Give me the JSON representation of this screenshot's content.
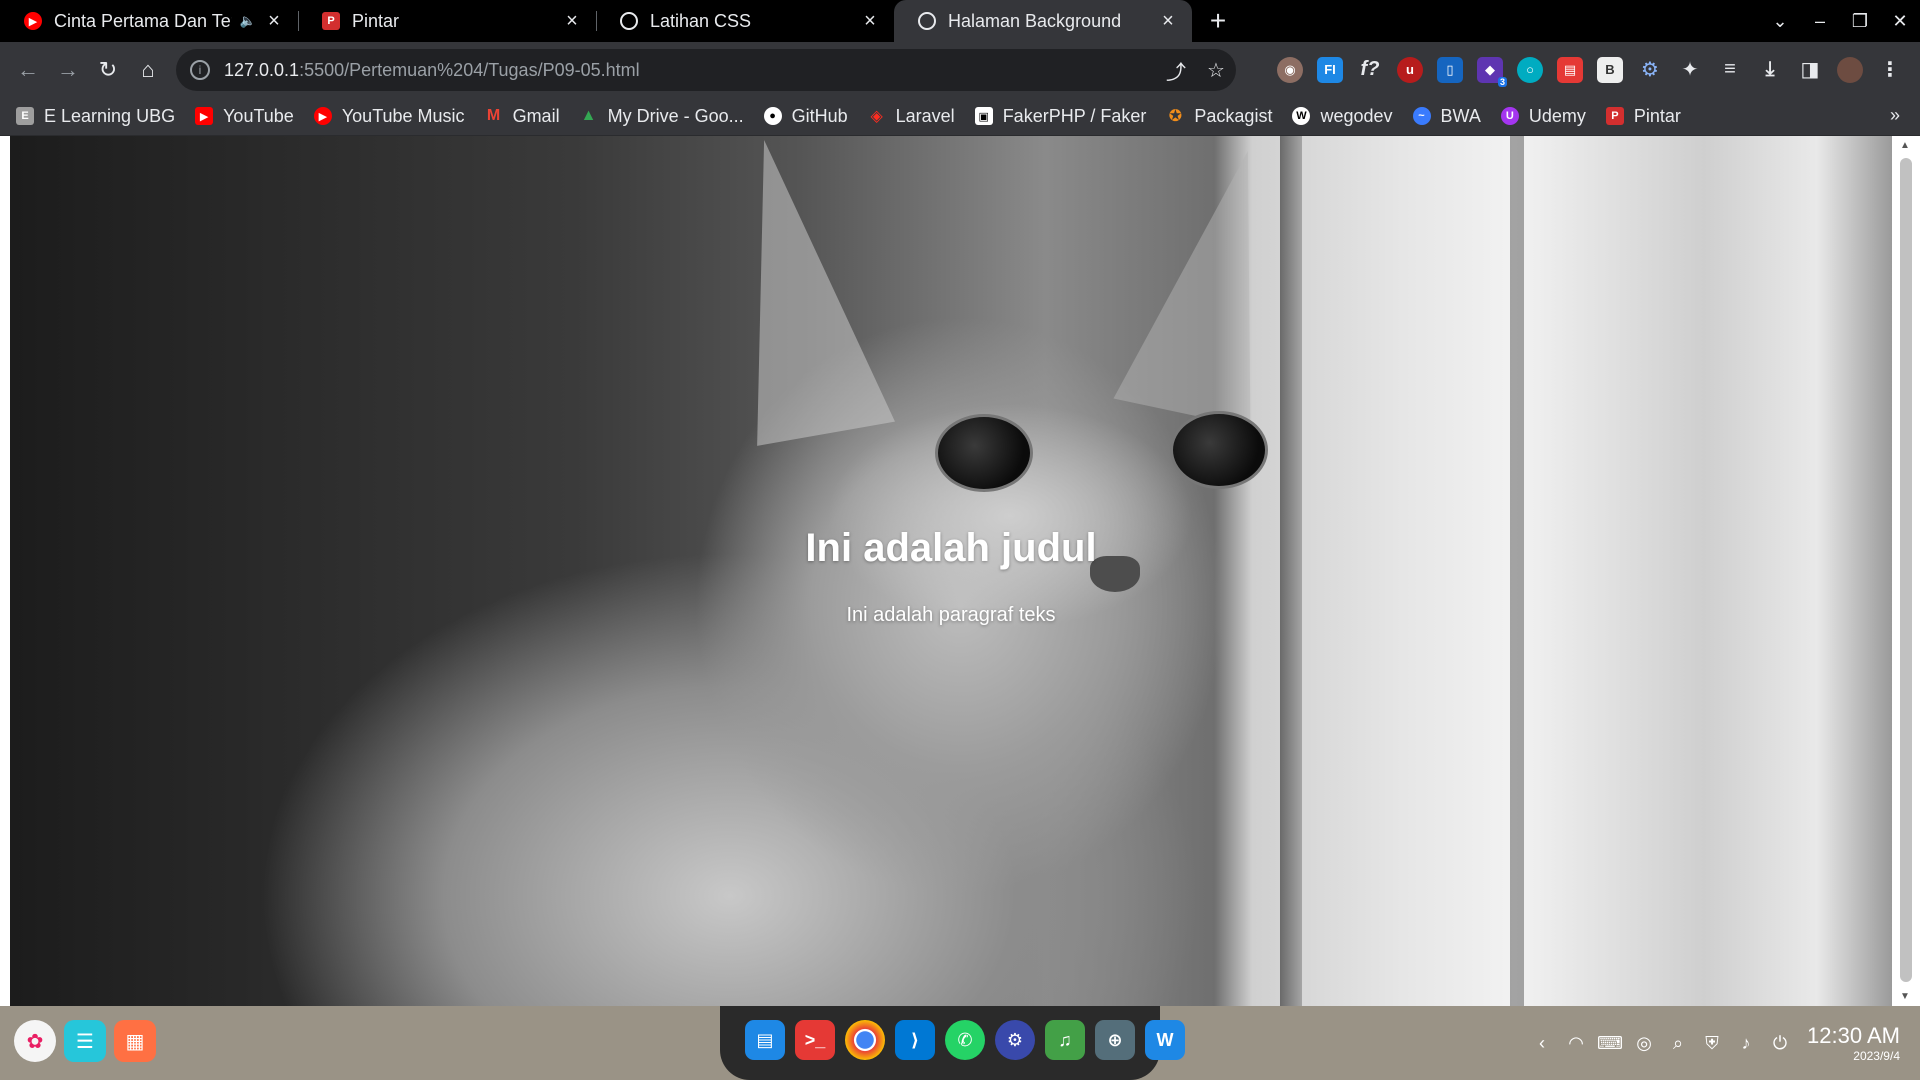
{
  "tabs": [
    {
      "title": "Cinta Pertama Dan Ter",
      "icon": "youtube-music-icon",
      "audio": true,
      "active": false
    },
    {
      "title": "Pintar",
      "icon": "pintar-icon",
      "active": false
    },
    {
      "title": "Latihan CSS",
      "icon": "globe-icon",
      "active": false
    },
    {
      "title": "Halaman Background",
      "icon": "globe-icon",
      "active": true
    }
  ],
  "address": {
    "host": "127.0.0.1",
    "path": ":5500/Pertemuan%204/Tugas/P09-05.html"
  },
  "bookmarks": [
    {
      "label": "E Learning UBG",
      "icon": "elearning-icon",
      "color": "#9e9e9e"
    },
    {
      "label": "YouTube",
      "icon": "youtube-icon",
      "color": "#ff0000"
    },
    {
      "label": "YouTube Music",
      "icon": "youtube-music-icon",
      "color": "#ff0000"
    },
    {
      "label": "Gmail",
      "icon": "gmail-icon",
      "color": "#ea4335"
    },
    {
      "label": "My Drive - Goo...",
      "icon": "google-drive-icon",
      "color": "#34a853"
    },
    {
      "label": "GitHub",
      "icon": "github-icon",
      "color": "#ffffff"
    },
    {
      "label": "Laravel",
      "icon": "laravel-icon",
      "color": "#ff2d20"
    },
    {
      "label": "FakerPHP / Faker",
      "icon": "faker-icon",
      "color": "#ffffff"
    },
    {
      "label": "Packagist",
      "icon": "packagist-icon",
      "color": "#f28d1a"
    },
    {
      "label": "wegodev",
      "icon": "wegodev-icon",
      "color": "#ffffff"
    },
    {
      "label": "BWA",
      "icon": "bwa-icon",
      "color": "#3a7bfd"
    },
    {
      "label": "Udemy",
      "icon": "udemy-icon",
      "color": "#a435f0"
    },
    {
      "label": "Pintar",
      "icon": "pintar-icon",
      "color": "#d32f2f"
    }
  ],
  "page": {
    "title": "Ini adalah judul",
    "paragraph": "Ini adalah paragraf teks"
  },
  "extensions_badge": "3",
  "clock": {
    "time": "12:30 AM",
    "date": "2023/9/4"
  }
}
